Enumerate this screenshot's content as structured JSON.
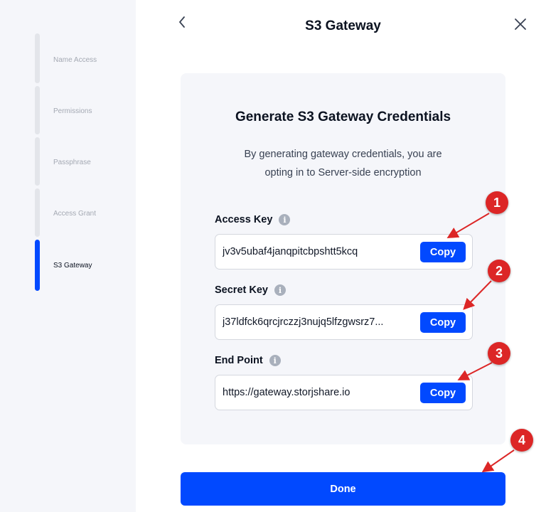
{
  "header": {
    "title": "S3 Gateway",
    "back_icon": "chevron-left",
    "close_icon": "close-x"
  },
  "sidebar": {
    "steps": [
      {
        "label": "Name Access",
        "active": false
      },
      {
        "label": "Permissions",
        "active": false
      },
      {
        "label": "Passphrase",
        "active": false
      },
      {
        "label": "Access Grant",
        "active": false
      },
      {
        "label": "S3 Gateway",
        "active": true
      }
    ]
  },
  "card": {
    "title": "Generate S3 Gateway Credentials",
    "description_line1": "By generating gateway credentials, you are",
    "description_line2": "opting in to Server-side encryption",
    "fields": [
      {
        "label": "Access Key",
        "value": "jv3v5ubaf4janqpitcbpshtt5kcq",
        "copy_label": "Copy"
      },
      {
        "label": "Secret Key",
        "value": "j37ldfck6qrcjrczzj3nujq5lfzgwsrz7...",
        "copy_label": "Copy"
      },
      {
        "label": "End Point",
        "value": "https://gateway.storjshare.io",
        "copy_label": "Copy"
      }
    ],
    "info_icon": "i"
  },
  "done_label": "Done",
  "annotations": [
    "1",
    "2",
    "3",
    "4"
  ],
  "colors": {
    "primary": "#0149FF",
    "annotation": "#DC2626",
    "sidebar_bg": "#F5F6FA",
    "card_bg": "#F5F6FA"
  }
}
